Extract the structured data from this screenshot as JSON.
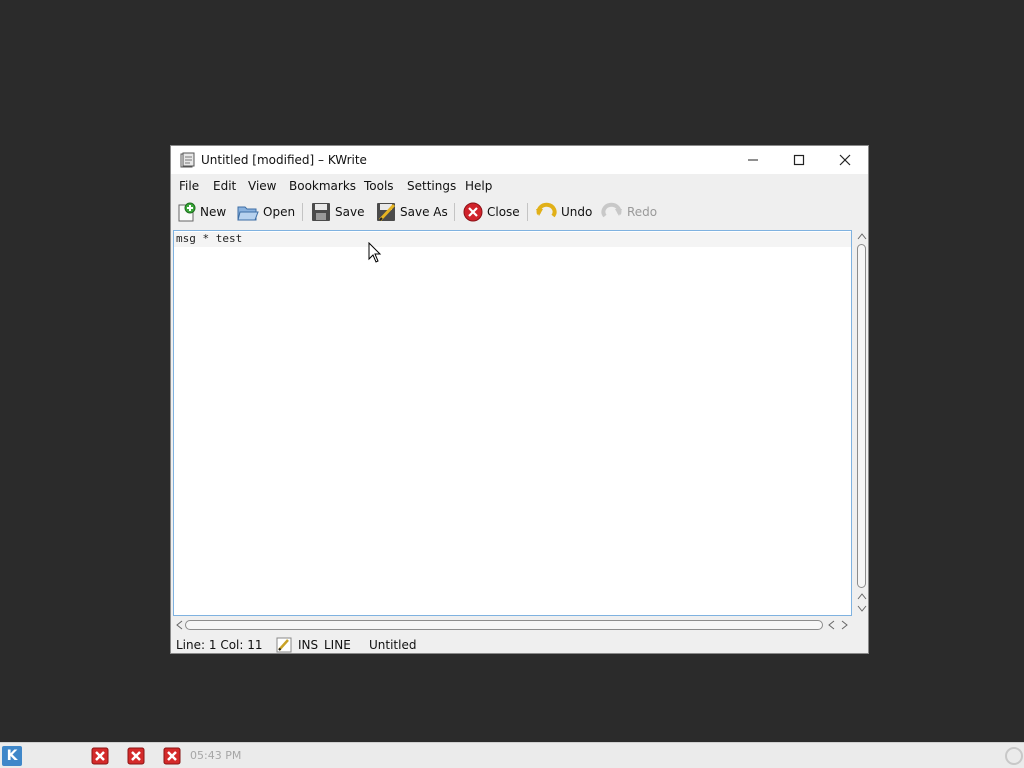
{
  "window": {
    "title": "Untitled [modified] – KWrite",
    "controls": [
      "minimize-icon",
      "maximize-icon",
      "close-icon"
    ]
  },
  "menubar": {
    "items": [
      "File",
      "Edit",
      "View",
      "Bookmarks",
      "Tools",
      "Settings",
      "Help"
    ]
  },
  "toolbar": {
    "new_label": "New",
    "open_label": "Open",
    "save_label": "Save",
    "save_as_label": "Save As",
    "close_label": "Close",
    "undo_label": "Undo",
    "redo_label": "Redo"
  },
  "editor": {
    "lines": [
      "msg * test"
    ]
  },
  "statusbar": {
    "position": "Line: 1 Col: 11",
    "insert_mode": "INS",
    "selection_mode": "LINE",
    "document_name": "Untitled"
  },
  "taskbar": {
    "clock": "05:43 PM"
  },
  "colors": {
    "desktop": "#2b2b2b",
    "window_bg": "#efefef",
    "editor_focus_border": "#7fb2e0",
    "taskbar_bg": "#ebebeb"
  }
}
